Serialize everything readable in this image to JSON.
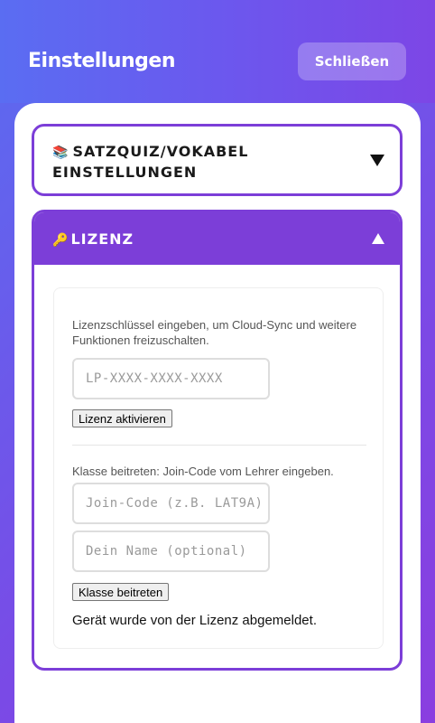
{
  "header": {
    "title": "Einstellungen",
    "close_label": "Schließen"
  },
  "sections": {
    "quiz": {
      "icon": "books-icon",
      "title_line1": "SATZQUIZ/VOKABEL",
      "title_line2": "EINSTELLUNGEN",
      "expanded": false
    },
    "license": {
      "icon": "key-icon",
      "title": "LIZENZ",
      "expanded": true,
      "license_hint": "Lizenzschlüssel eingeben, um Cloud-Sync und weitere Funktionen freizuschalten.",
      "license_placeholder": "LP-XXXX-XXXX-XXXX",
      "activate_label": "Lizenz aktivieren",
      "class_hint": "Klasse beitreten: Join-Code vom Lehrer eingeben.",
      "join_placeholder": "Join-Code (z.B. LAT9A)",
      "name_placeholder": "Dein Name (optional)",
      "join_label": "Klasse beitreten",
      "status": "Gerät wurde von der Lizenz abgemeldet."
    }
  },
  "colors": {
    "accent": "#7c3ed8",
    "gradient_start": "#5a6cf0",
    "gradient_end": "#8a3ee0"
  }
}
